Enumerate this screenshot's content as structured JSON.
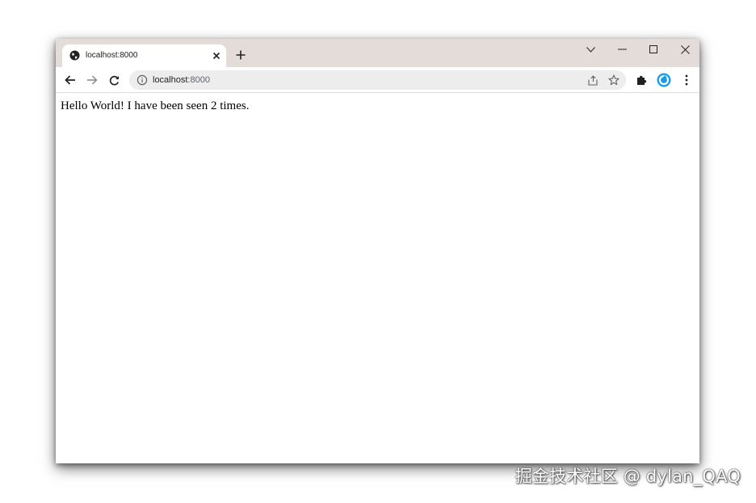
{
  "browser": {
    "tab": {
      "title": "localhost:8000",
      "close_glyph": "×",
      "favicon": "globe-icon"
    },
    "newtab_glyph": "+",
    "window_controls": {
      "tab_search_glyph": "⌵",
      "minimize_glyph": "–",
      "maximize_glyph": "□",
      "close_glyph": "✕"
    },
    "toolbar": {
      "back_glyph": "←",
      "forward_glyph": "→",
      "reload_glyph": "C",
      "url_host": "localhost",
      "url_port": ":8000",
      "star_glyph": "☆",
      "menu_glyph": "⋮"
    }
  },
  "page": {
    "text": "Hello World! I have been seen 2 times."
  },
  "watermark": "掘金技术社区 @ dylan_QAQ",
  "colors": {
    "tabstrip": "#e3dcd8",
    "omnibox": "#ededed",
    "profile_avatar": "#1a9be8"
  }
}
